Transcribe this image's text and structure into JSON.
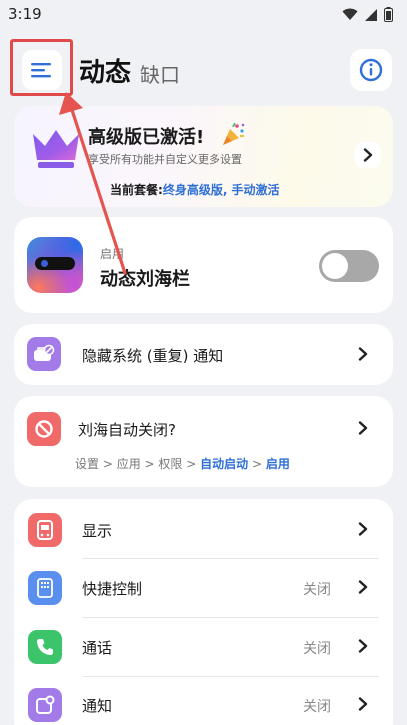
{
  "status_bar": {
    "time": "3:19"
  },
  "header": {
    "title": "动态",
    "subtitle": "缺口"
  },
  "premium": {
    "title": "高级版已激活!",
    "description": "享受所有功能并自定义更多设置",
    "plan_label": "当前套餐:",
    "plan_value": "终身高级版, 手动激活"
  },
  "notch": {
    "status_label": "启用",
    "title": "动态刘海栏",
    "toggle_on": false
  },
  "hide_notifications": {
    "label": "隐藏系统 (重复) 通知"
  },
  "auto_close": {
    "label": "刘海自动关闭?",
    "path": [
      "设置",
      "应用",
      "权限",
      "自动启动",
      "启用"
    ],
    "separator": " > "
  },
  "settings": {
    "items": [
      {
        "label": "显示",
        "value": ""
      },
      {
        "label": "快捷控制",
        "value": "关闭"
      },
      {
        "label": "通话",
        "value": "关闭"
      },
      {
        "label": "通知",
        "value": "关闭"
      }
    ]
  },
  "icons": {
    "menu": "menu-icon",
    "info": "info-icon",
    "crown": "crown-icon",
    "party": "party-popper-icon",
    "hide": "notification-off-icon",
    "ban": "ban-icon",
    "display": "display-icon",
    "quick": "quick-control-icon",
    "phone": "phone-icon",
    "notify": "notification-icon"
  },
  "colors": {
    "accent_blue": "#2f6fd6",
    "highlight_red": "#e04a4a",
    "icon_purple": "#a37be8",
    "icon_red": "#f06a6a",
    "icon_blue": "#5a8ff0",
    "icon_green": "#3cc46b"
  }
}
